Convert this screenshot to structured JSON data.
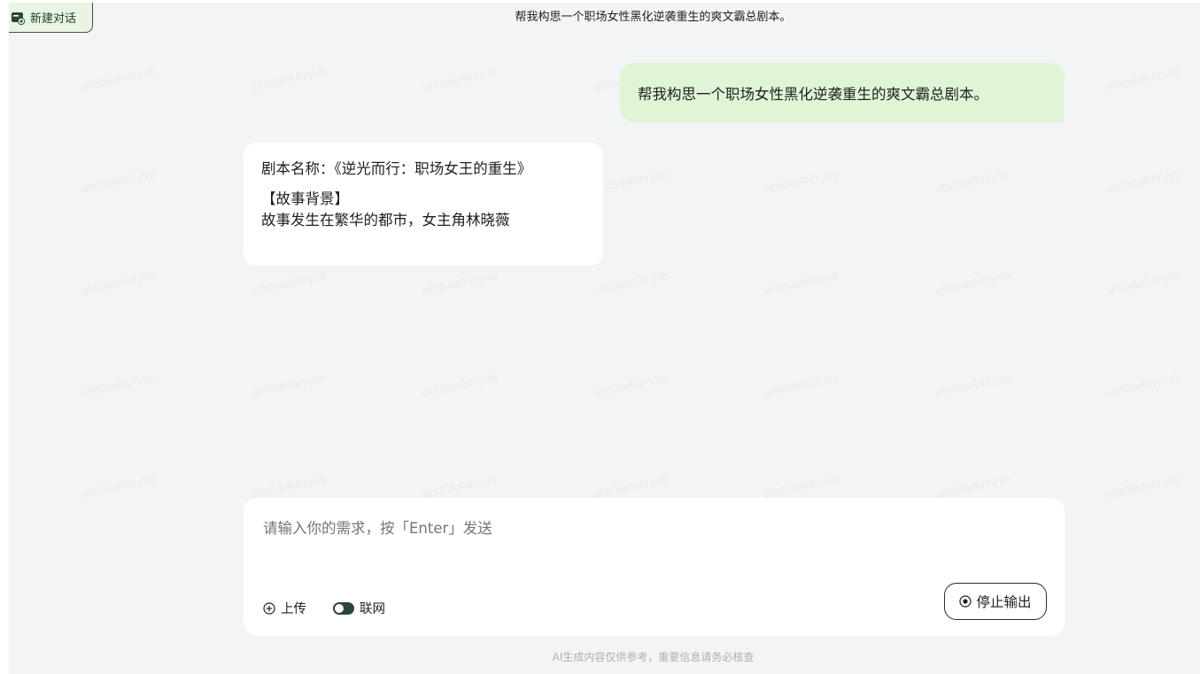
{
  "header": {
    "new_chat_label": "新建对话",
    "title": "帮我构思一个职场女性黑化逆袭重生的爽文霸总剧本。"
  },
  "messages": {
    "user": "帮我构思一个职场女性黑化逆袭重生的爽文霸总剧本。",
    "assistant": {
      "line1": "剧本名称：《逆光而行：职场女王的重生》",
      "line2": "【故事背景】",
      "line3": "故事发生在繁华的都市，女主角林晓薇"
    }
  },
  "input": {
    "placeholder": "请输入你的需求，按「Enter」发送",
    "upload_label": "上传",
    "web_label": "联网",
    "web_enabled": true,
    "stop_label": "停止输出"
  },
  "footer": {
    "note": "AI生成内容仅供参考，重要信息请务必核查"
  },
  "colors": {
    "page_bg": "#f3f4f6",
    "user_bubble": "#dff5d6",
    "accent_dark_green": "#2a4736",
    "new_chat_bg": "#e8f5e4"
  },
  "icons": {
    "new_chat": "new-chat-icon",
    "upload": "plus-circle-icon",
    "web": "toggle-icon",
    "stop": "stop-circle-icon"
  }
}
